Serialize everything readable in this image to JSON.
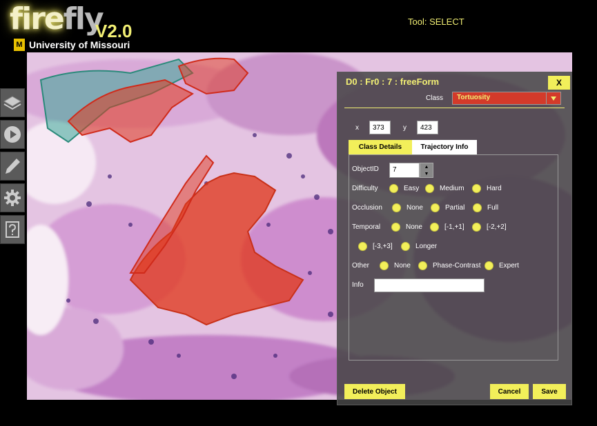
{
  "app": {
    "logo_fire": "fire",
    "logo_fly": "fly",
    "version": "V2.0",
    "university": "University of Missouri",
    "mu_mark": "M"
  },
  "tool_status": "Tool: SELECT",
  "sidebar": {
    "items": [
      "layers-icon",
      "play-icon",
      "pencil-icon",
      "gear-icon",
      "help-icon"
    ]
  },
  "panel": {
    "title": "D0 : Fr0 : 7 : freeForm",
    "close_label": "X",
    "class_label": "Class",
    "class_value": "Tortuosity",
    "x_label": "x",
    "x_value": "373",
    "y_label": "y",
    "y_value": "423",
    "tabs": [
      "Class Details",
      "Trajectory Info"
    ],
    "object_id_label": "ObjectID",
    "object_id_value": "7",
    "difficulty": {
      "label": "Difficulty",
      "options": [
        "Easy",
        "Medium",
        "Hard"
      ]
    },
    "occlusion": {
      "label": "Occlusion",
      "options": [
        "None",
        "Partial",
        "Full"
      ]
    },
    "temporal": {
      "label": "Temporal",
      "options": [
        "None",
        "[-1,+1]",
        "[-2,+2]",
        "[-3,+3]",
        "Longer"
      ]
    },
    "other": {
      "label": "Other",
      "options": [
        "None",
        "Phase-Contrast",
        "Expert"
      ]
    },
    "info_label": "Info",
    "info_value": "",
    "delete_label": "Delete Object",
    "cancel_label": "Cancel",
    "save_label": "Save"
  },
  "colors": {
    "accent": "#f2ef5a",
    "class_red": "#d33a2a",
    "overlay_red": "#e03a1e",
    "overlay_teal": "#2a9a8a"
  }
}
